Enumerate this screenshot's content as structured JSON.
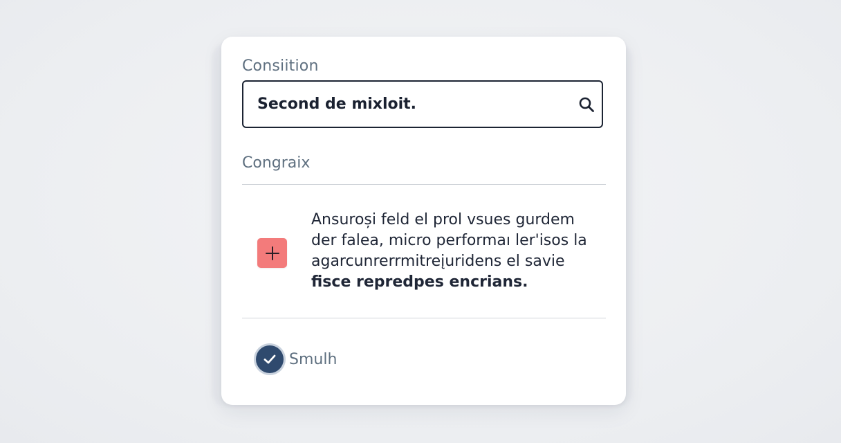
{
  "form": {
    "condition_label": "Consiition",
    "search": {
      "value": "Second de mixloit.",
      "icon": "search-icon"
    },
    "section_label": "Congraix",
    "add_button": {
      "icon": "plus-icon",
      "color": "#f37b7b"
    },
    "description_lines": [
      "Ansuroși feld el prol vsues gurdem",
      "der falea, micro performaı ler'isos la",
      "agarcunrerrmitreįuridens el savie",
      "fisce repredpes encrians."
    ],
    "confirm": {
      "label": "Smulh",
      "checked": true,
      "icon": "check-icon",
      "color": "#2f4a6e"
    }
  }
}
